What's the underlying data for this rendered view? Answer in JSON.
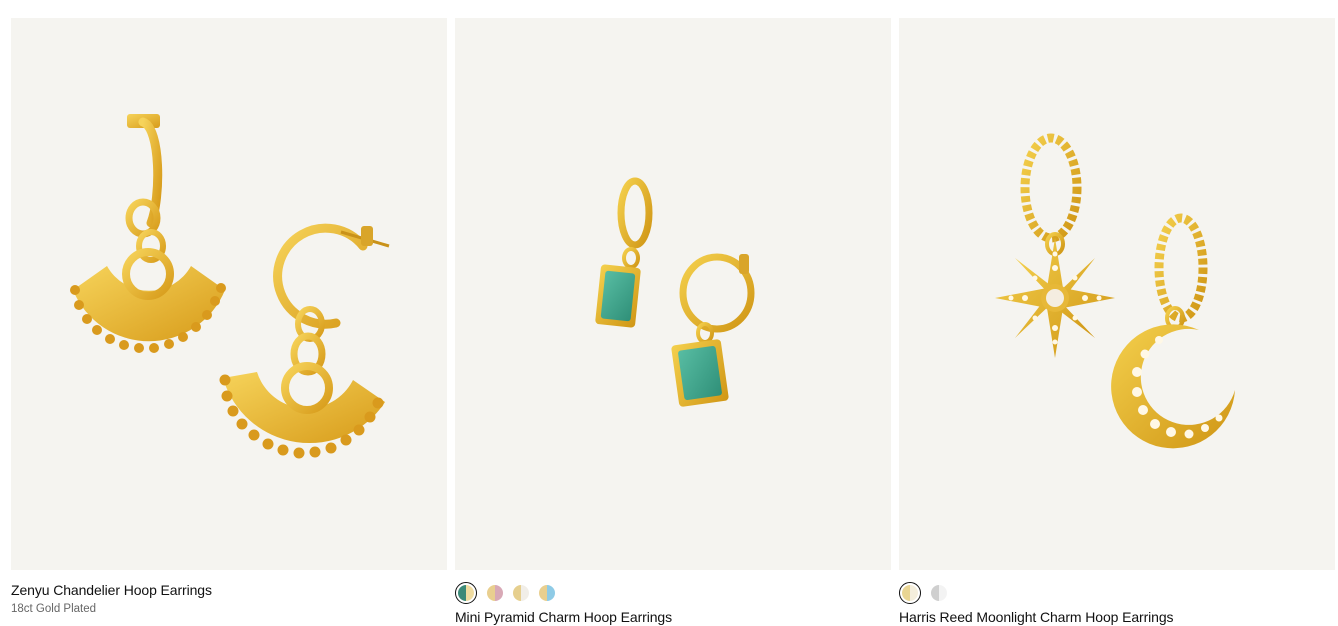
{
  "colors": {
    "image_bg": "#f5f4f0",
    "gold": "#e3b22c",
    "gold_dark": "#c98f14",
    "amazonite": "#3fa48c",
    "pearl": "#f4ede0"
  },
  "products": [
    {
      "name": "Zenyu Chandelier Hoop Earrings",
      "material": "18ct Gold Plated",
      "image_icon": "fan-chandelier-earrings-image"
    },
    {
      "name": "Mini Pyramid Charm Hoop Earrings",
      "image_icon": "amazonite-charm-hoop-earrings-image",
      "swatches": [
        {
          "left": "#3c8a78",
          "right": "#f0dca0",
          "selected": true
        },
        {
          "left": "#e9cf8f",
          "right": "#d8a9b6",
          "selected": false
        },
        {
          "left": "#e6cf8e",
          "right": "#f1eee8",
          "selected": false
        },
        {
          "left": "#e9cf8f",
          "right": "#8fcbe6",
          "selected": false
        }
      ]
    },
    {
      "name": "Harris Reed Moonlight Charm Hoop Earrings",
      "image_icon": "star-moon-charm-earrings-image",
      "swatches": [
        {
          "left": "#e9d593",
          "right": "#f4eedc",
          "selected": true
        },
        {
          "left": "#cfcfcf",
          "right": "#f3f3f3",
          "selected": false
        }
      ]
    }
  ]
}
